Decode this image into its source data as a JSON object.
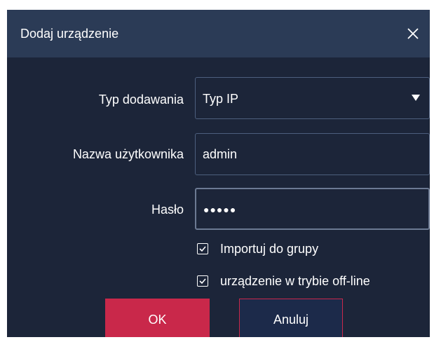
{
  "dialog": {
    "title": "Dodaj urządzenie",
    "close_icon": "close-icon"
  },
  "form": {
    "add_type": {
      "label": "Typ dodawania",
      "value": "Typ IP",
      "icon": "caret-down-icon"
    },
    "username": {
      "label": "Nazwa użytkownika",
      "value": "admin"
    },
    "password": {
      "label": "Hasło",
      "value": "●●●●●"
    }
  },
  "options": [
    {
      "label": "Importuj do grupy",
      "checked": true
    },
    {
      "label": "urządzenie w trybie off-line",
      "checked": true
    }
  ],
  "buttons": {
    "ok_label": "OK",
    "cancel_label": "Anuluj"
  },
  "colors": {
    "titlebar": "#2b3b56",
    "body": "#1c2539",
    "accent": "#c9284a",
    "field_border": "#4d5f7e"
  }
}
